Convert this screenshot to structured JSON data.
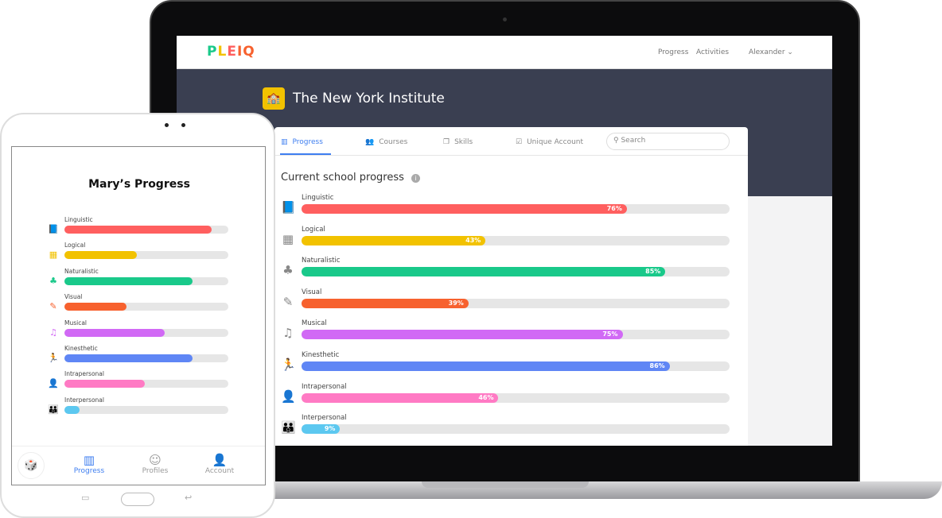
{
  "laptop": {
    "header": {
      "logo": "PLEIQ",
      "nav": [
        "Progress",
        "Activities"
      ],
      "user": "Alexander"
    },
    "school": "The New York Institute",
    "tabs": [
      {
        "label": "Progress",
        "icon": "bar-chart-icon",
        "active": true
      },
      {
        "label": "Courses",
        "icon": "group-icon"
      },
      {
        "label": "Skills",
        "icon": "copy-icon"
      },
      {
        "label": "Unique Account",
        "icon": "checkbox-device-icon"
      }
    ],
    "search_placeholder": "Search",
    "section_title": "Current school progress",
    "skills": [
      {
        "label": "Linguistic",
        "value": 76,
        "display": "76%",
        "color": "#ff5f5f",
        "icon": "book-icon",
        "glyph": "📘"
      },
      {
        "label": "Logical",
        "value": 43,
        "display": "43%",
        "color": "#f2c200",
        "icon": "calculator-icon",
        "glyph": "▦"
      },
      {
        "label": "Naturalistic",
        "value": 85,
        "display": "85%",
        "color": "#19c98a",
        "icon": "tree-icon",
        "glyph": "♣"
      },
      {
        "label": "Visual",
        "value": 39,
        "display": "39%",
        "color": "#f7612e",
        "icon": "brush-icon",
        "glyph": "✎"
      },
      {
        "label": "Musical",
        "value": 75,
        "display": "75%",
        "color": "#d169f5",
        "icon": "music-note-icon",
        "glyph": "♫"
      },
      {
        "label": "Kinesthetic",
        "value": 86,
        "display": "86%",
        "color": "#5f86f5",
        "icon": "running-icon",
        "glyph": "🏃"
      },
      {
        "label": "Intrapersonal",
        "value": 46,
        "display": "46%",
        "color": "#ff7ac4",
        "icon": "person-icon",
        "glyph": "👤"
      },
      {
        "label": "Interpersonal",
        "value": 9,
        "display": "9%",
        "color": "#5cc8f0",
        "icon": "people-icon",
        "glyph": "👪"
      }
    ]
  },
  "tablet": {
    "title": "Mary’s Progress",
    "skills": [
      {
        "label": "Linguistic",
        "value": 90,
        "color": "#ff5f5f"
      },
      {
        "label": "Logical",
        "value": 44,
        "color": "#f2c200"
      },
      {
        "label": "Naturalistic",
        "value": 78,
        "color": "#19c98a"
      },
      {
        "label": "Visual",
        "value": 38,
        "color": "#f7612e"
      },
      {
        "label": "Musical",
        "value": 61,
        "color": "#d169f5"
      },
      {
        "label": "Kinesthetic",
        "value": 78,
        "color": "#5f86f5"
      },
      {
        "label": "Intrapersonal",
        "value": 49,
        "color": "#ff7ac4"
      },
      {
        "label": "Interpersonal",
        "value": 9,
        "color": "#5cc8f0"
      }
    ],
    "nav": [
      {
        "label": "Progress",
        "icon": "bar-chart-icon",
        "active": true
      },
      {
        "label": "Profiles",
        "icon": "face-icon"
      },
      {
        "label": "Account",
        "icon": "user-icon"
      }
    ]
  }
}
